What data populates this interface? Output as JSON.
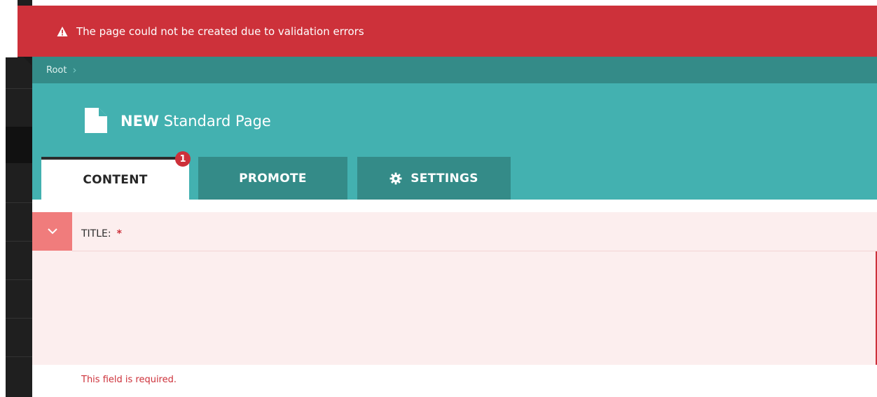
{
  "alert": {
    "message": "The page could not be created due to validation errors",
    "icon": "warning-icon",
    "color": "#cd313a"
  },
  "breadcrumb": {
    "items": [
      "Root"
    ]
  },
  "header": {
    "title_prefix": "NEW",
    "title_rest": "Standard Page",
    "icon": "document-icon",
    "color": "#43b1b0"
  },
  "tabs": [
    {
      "label": "CONTENT",
      "active": true,
      "error_count": "1"
    },
    {
      "label": "PROMOTE",
      "active": false
    },
    {
      "label": "SETTINGS",
      "active": false,
      "icon": "gear-icon"
    }
  ],
  "field": {
    "label": "TITLE:",
    "required_marker": "*",
    "value": "",
    "error": "This field is required.",
    "toggle_icon": "chevron-down-icon"
  }
}
